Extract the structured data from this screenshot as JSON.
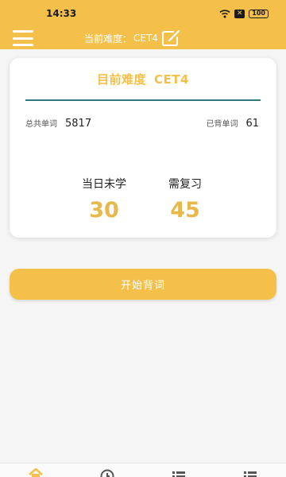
{
  "status_bar": {
    "time": "14:33",
    "x_badge": "✕",
    "battery": "100"
  },
  "header": {
    "difficulty_label": "当前难度：",
    "difficulty_value": "CET4",
    "icons": [
      "menu-icon",
      "edit-icon"
    ]
  },
  "card": {
    "title_label": "目前难度",
    "title_value": "CET4",
    "total_label": "总共单词",
    "total_value": "5817",
    "learned_label": "已背单词",
    "learned_value": "61",
    "today_label": "当日未学",
    "today_value": "30",
    "review_label": "需复习",
    "review_value": "45"
  },
  "start_button": {
    "label": "开始背词"
  },
  "bottom_nav": {
    "items": [
      "home-icon",
      "history-icon",
      "list-icon",
      "list-icon-2"
    ]
  },
  "colors": {
    "accent": "#f4c04a",
    "number": "#e8b84a",
    "divider": "#2f7a7a",
    "background": "#f5f5f5"
  }
}
